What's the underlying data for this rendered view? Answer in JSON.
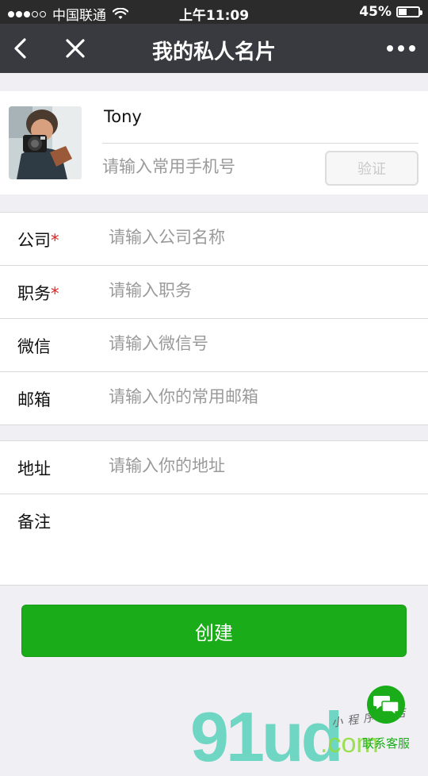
{
  "status_bar": {
    "carrier": "中国联通",
    "time": "上午11:09",
    "battery": "45%",
    "battery_level": 0.45
  },
  "nav": {
    "title": "我的私人名片",
    "back_icon": "chevron-left-icon",
    "close_icon": "close-icon",
    "more_icon": "more-dots-icon"
  },
  "profile": {
    "name": "Tony",
    "phone_placeholder": "请输入常用手机号",
    "verify_label": "验证"
  },
  "form_group1": [
    {
      "label": "公司",
      "required": "*",
      "placeholder": "请输入公司名称"
    },
    {
      "label": "职务",
      "required": "*",
      "placeholder": "请输入职务"
    },
    {
      "label": "微信",
      "required": "",
      "placeholder": "请输入微信号"
    },
    {
      "label": "邮箱",
      "required": "",
      "placeholder": "请输入你的常用邮箱"
    }
  ],
  "form_group2": {
    "address": {
      "label": "地址",
      "placeholder": "请输入你的地址"
    },
    "remarks": {
      "label": "备注"
    }
  },
  "create_button": "创建",
  "service": {
    "label": "联系客服",
    "icon": "chat-bubbles-icon"
  },
  "watermark": {
    "logo": "91ud",
    "domain": ".com",
    "subtitle": "小程序商店"
  },
  "colors": {
    "nav_bg": "#393a3f",
    "accent_green": "#1aad19",
    "required_red": "#e02020"
  }
}
